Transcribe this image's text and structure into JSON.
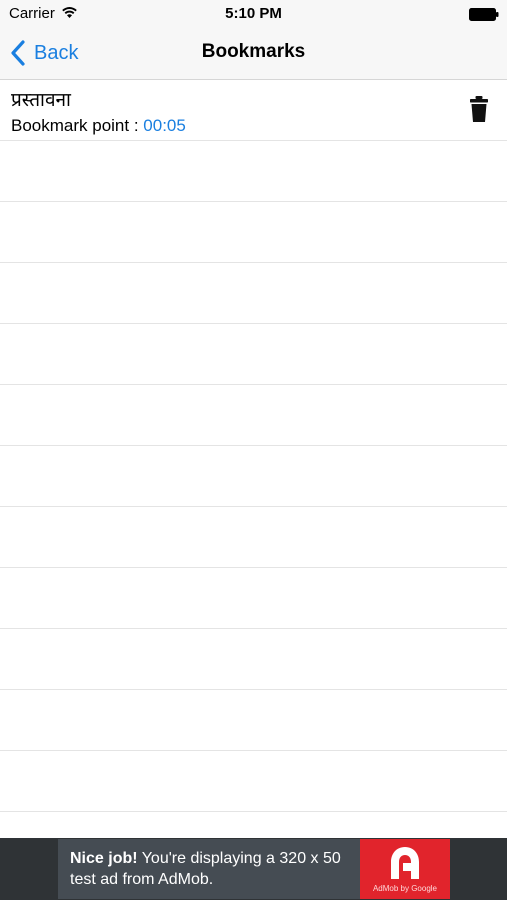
{
  "status_bar": {
    "carrier": "Carrier",
    "time": "5:10 PM"
  },
  "nav": {
    "back_label": "Back",
    "title": "Bookmarks"
  },
  "bookmarks": [
    {
      "title": "प्रस्तावना",
      "point_label": "Bookmark point :",
      "time": "00:05"
    }
  ],
  "empty_row_count": 11,
  "ad": {
    "headline": "Nice job!",
    "body": " You're displaying a 320 x 50 test ad from AdMob.",
    "brand": "AdMob by Google"
  },
  "colors": {
    "accent": "#1a7fe0",
    "ad_red": "#e1242c",
    "ad_dark": "#2f3336"
  },
  "icons": [
    "wifi-icon",
    "battery-icon",
    "chevron-left-icon",
    "trash-icon",
    "admob-logo-icon"
  ]
}
